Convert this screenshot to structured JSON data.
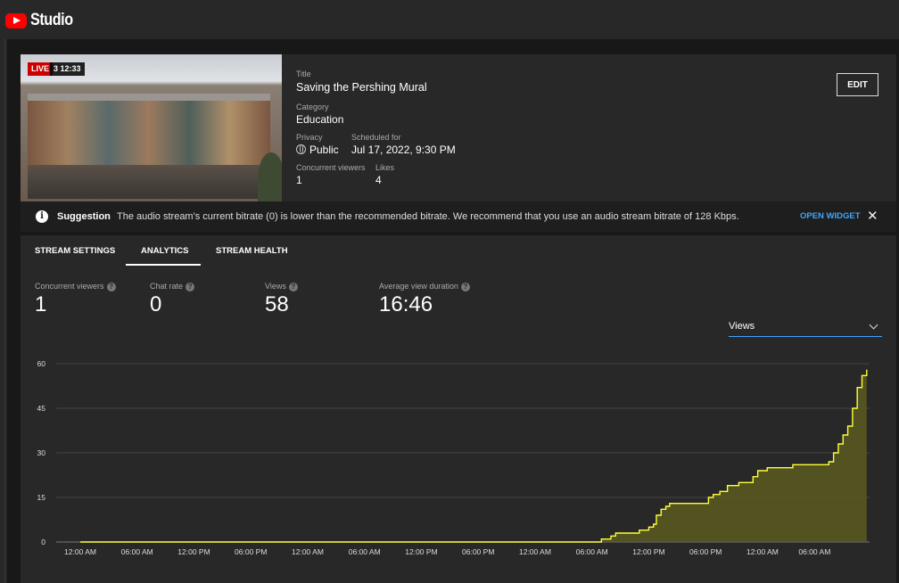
{
  "app": {
    "name": "Studio"
  },
  "stream": {
    "live_badge": "LIVE",
    "elapsed": "3 12:33",
    "title_label": "Title",
    "title": "Saving the Pershing Mural",
    "category_label": "Category",
    "category": "Education",
    "privacy_label": "Privacy",
    "privacy": "Public",
    "scheduled_label": "Scheduled for",
    "scheduled": "Jul 17, 2022, 9:30 PM",
    "viewers_label": "Concurrent viewers",
    "viewers": "1",
    "likes_label": "Likes",
    "likes": "4",
    "edit_label": "EDIT"
  },
  "suggestion": {
    "title": "Suggestion",
    "text": "The audio stream's current bitrate (0) is lower than the recommended bitrate. We recommend that you use an audio stream bitrate of 128 Kbps.",
    "action": "OPEN WIDGET"
  },
  "tabs": [
    {
      "label": "STREAM SETTINGS"
    },
    {
      "label": "ANALYTICS",
      "active": true
    },
    {
      "label": "STREAM HEALTH"
    }
  ],
  "stats": [
    {
      "label": "Concurrent viewers",
      "value": "1"
    },
    {
      "label": "Chat rate",
      "value": "0"
    },
    {
      "label": "Views",
      "value": "58"
    },
    {
      "label": "Average view duration",
      "value": "16:46"
    }
  ],
  "metric_select": {
    "value": "Views"
  },
  "colors": {
    "line": "#ffff3a",
    "fill": "#5a5a20",
    "accent": "#3ea6ff",
    "live": "#cc0000"
  },
  "chart_data": {
    "type": "area",
    "ylim": [
      0,
      60
    ],
    "yticks": [
      "0",
      "15",
      "30",
      "45",
      "60"
    ],
    "xticks": [
      "12:00 AM",
      "06:00 AM",
      "12:00 PM",
      "06:00 PM",
      "12:00 AM",
      "06:00 AM",
      "12:00 PM",
      "06:00 PM",
      "12:00 AM",
      "06:00 AM",
      "12:00 PM",
      "06:00 PM",
      "12:00 AM",
      "06:00 AM"
    ],
    "x_hours": [
      0,
      6,
      12,
      18,
      24,
      30,
      36,
      42,
      48,
      54,
      60,
      66,
      72,
      77.5
    ],
    "series": [
      {
        "values": [
          [
            0,
            0
          ],
          [
            54,
            0
          ],
          [
            54.2,
            0
          ],
          [
            55,
            1
          ],
          [
            56,
            2
          ],
          [
            56.5,
            3
          ],
          [
            58.5,
            3
          ],
          [
            59,
            4
          ],
          [
            60,
            5
          ],
          [
            60.5,
            6
          ],
          [
            60.8,
            9
          ],
          [
            61.3,
            11
          ],
          [
            61.8,
            12
          ],
          [
            62.2,
            13
          ],
          [
            66,
            13
          ],
          [
            66.3,
            15
          ],
          [
            66.8,
            16
          ],
          [
            67.5,
            17
          ],
          [
            68.3,
            19
          ],
          [
            69.5,
            20
          ],
          [
            70.5,
            20
          ],
          [
            71,
            22
          ],
          [
            71.5,
            24
          ],
          [
            72.5,
            25
          ],
          [
            75,
            25
          ],
          [
            75.2,
            26
          ],
          [
            78.5,
            26
          ],
          [
            79,
            27
          ],
          [
            79.5,
            30
          ],
          [
            80,
            33
          ],
          [
            80.5,
            36
          ],
          [
            81,
            39
          ],
          [
            81.5,
            45
          ],
          [
            82,
            52
          ],
          [
            82.5,
            56
          ],
          [
            83,
            58
          ]
        ]
      }
    ]
  }
}
